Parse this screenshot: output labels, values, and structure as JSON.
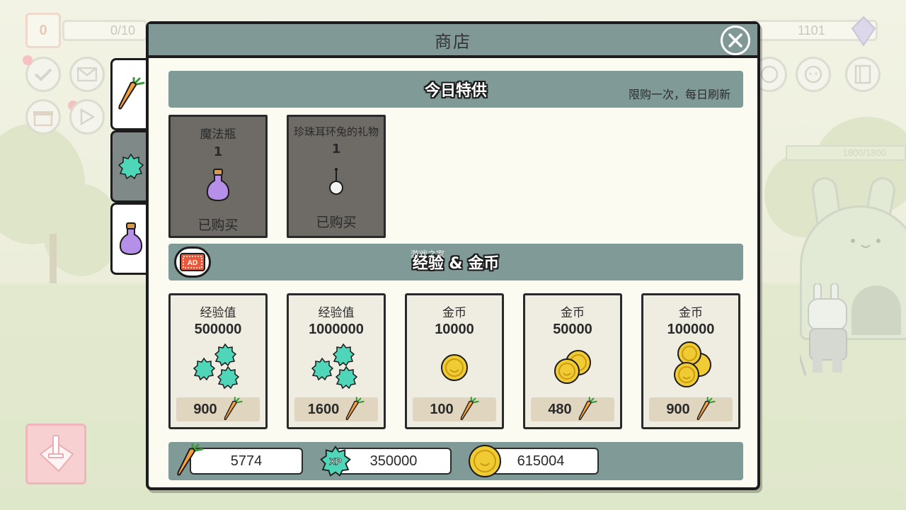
{
  "hud": {
    "level": "0",
    "exp_progress": "0/10",
    "gems": "1101",
    "hp": "1800/1800"
  },
  "shop": {
    "title": "商店",
    "close_icon": "close-icon",
    "tabs": [
      {
        "name": "carrot-tab",
        "icon": "carrot-icon"
      },
      {
        "name": "xp-tab",
        "icon": "xp-icon",
        "active": true
      },
      {
        "name": "potion-tab",
        "icon": "potion-icon"
      }
    ],
    "daily": {
      "title": "今日特供",
      "note": "限购一次，每日刷新",
      "items": [
        {
          "name": "魔法瓶",
          "qty": "1",
          "status": "已购买",
          "icon": "potion-icon"
        },
        {
          "name": "珍珠耳环兔的礼物",
          "qty": "1",
          "status": "已购买",
          "icon": "pearl-earring-icon"
        }
      ]
    },
    "exp_gold": {
      "title": "经验 & 金币",
      "ad_icon": "ad-icon",
      "items": [
        {
          "name": "经验值",
          "amount": "500000",
          "price": "900",
          "icon": "xp-bundle-icon"
        },
        {
          "name": "经验值",
          "amount": "1000000",
          "price": "1600",
          "icon": "xp-bundle-icon"
        },
        {
          "name": "金币",
          "amount": "10000",
          "price": "100",
          "icon": "coin-icon"
        },
        {
          "name": "金币",
          "amount": "50000",
          "price": "480",
          "icon": "coin-stack-icon"
        },
        {
          "name": "金币",
          "amount": "100000",
          "price": "900",
          "icon": "coin-pile-icon"
        }
      ]
    },
    "balances": {
      "carrots": "5774",
      "xp": "350000",
      "gold": "615004"
    }
  },
  "watermark": "游戏之家",
  "colors": {
    "header": "#809997",
    "card_bg": "#efece2",
    "bought_card": "#6e6a66",
    "xp_green": "#4fd6b8",
    "coin_gold": "#f0cb33",
    "carrot_orange": "#f5a03a"
  }
}
